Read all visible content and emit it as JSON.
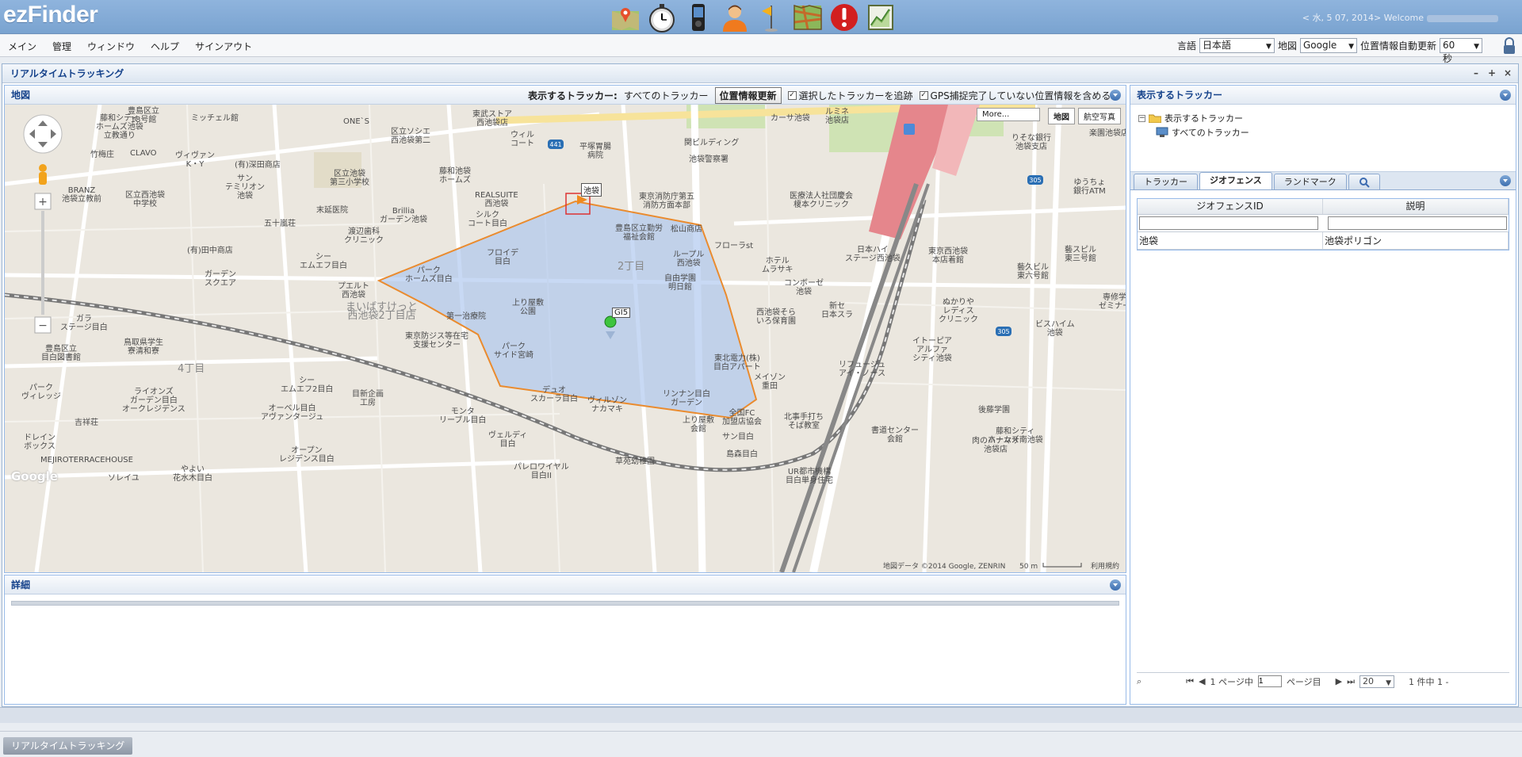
{
  "header": {
    "logo": "ezFinder",
    "welcome": "< 水, 5 07, 2014> Welcome",
    "toolbar_icons": [
      "map-tracker-icon",
      "stopwatch-icon",
      "device-icon",
      "user-icon",
      "flag-icon",
      "route-map-icon",
      "alert-icon",
      "report-icon"
    ]
  },
  "menu": {
    "items": [
      "メイン",
      "管理",
      "ウィンドウ",
      "ヘルプ",
      "サインアウト"
    ]
  },
  "settings": {
    "lang_label": "言語",
    "lang_value": "日本語",
    "map_label": "地図",
    "map_value": "Google",
    "refresh_label": "位置情報自動更新",
    "refresh_value": "60 秒"
  },
  "window": {
    "title": "リアルタイムトラッキング"
  },
  "map_panel": {
    "title": "地図",
    "tracker_label": "表示するトラッカー:",
    "tracker_value": "すべてのトラッカー",
    "update_button": "位置情報更新",
    "chk_follow": "選択したトラッカーを追跡",
    "chk_gps": "GPS捕捉完了していない位置情報を含める",
    "more_button": "More...",
    "map_type_map": "地図",
    "map_type_sat": "航空写真",
    "geo_label": "池袋",
    "tracker_name": "GI5",
    "attribution": "地図データ ©2014 Google, ZENRIN",
    "scale": "50 m",
    "terms": "利用規約",
    "google": "Google"
  },
  "map_labels": [
    {
      "t": "豊島区立\n18号館",
      "l": 155,
      "tp": 3
    },
    {
      "t": "ミッチェル館",
      "l": 235,
      "tp": 12
    },
    {
      "t": "藤和シティ\nホームズ池袋\n立教通り",
      "l": 115,
      "tp": 12
    },
    {
      "t": "ONE`S",
      "l": 427,
      "tp": 16
    },
    {
      "t": "東武ストア\n西池袋店",
      "l": 590,
      "tp": 7
    },
    {
      "t": "ルミネ\n池袋店",
      "l": 1035,
      "tp": 4
    },
    {
      "t": "カーサ池袋",
      "l": 966,
      "tp": 12
    },
    {
      "t": "ウィル\nコート",
      "l": 638,
      "tp": 33
    },
    {
      "t": "平塚胃腸\n病院",
      "l": 725,
      "tp": 48
    },
    {
      "t": "関ビルディング",
      "l": 857,
      "tp": 43
    },
    {
      "t": "池袋警察署",
      "l": 863,
      "tp": 64
    },
    {
      "t": "区立池袋\n第三小学校",
      "l": 410,
      "tp": 82
    },
    {
      "t": "藤和池袋\nホームズ",
      "l": 548,
      "tp": 79
    },
    {
      "t": "CLAVO",
      "l": 158,
      "tp": 56
    },
    {
      "t": "竹梅庄",
      "l": 108,
      "tp": 58
    },
    {
      "t": "ヴィヴァン\nK・Y",
      "l": 215,
      "tp": 59
    },
    {
      "t": "(有)深田商店",
      "l": 290,
      "tp": 71
    },
    {
      "t": "区立ソシエ\n西池袋第二",
      "l": 487,
      "tp": 29
    },
    {
      "t": "BRANZ\n池袋立教前",
      "l": 72,
      "tp": 103
    },
    {
      "t": "区立西池袋\n中学校",
      "l": 152,
      "tp": 109
    },
    {
      "t": "サン\nテミリオン\n池袋",
      "l": 278,
      "tp": 88
    },
    {
      "t": "REALSUITE\n西池袋",
      "l": 593,
      "tp": 109
    },
    {
      "t": "東京消防庁第五\n消防方面本部",
      "l": 800,
      "tp": 111
    },
    {
      "t": "医療法人社団慶会\n榎本クリニック",
      "l": 990,
      "tp": 110
    },
    {
      "t": "末延医院",
      "l": 393,
      "tp": 128
    },
    {
      "t": "Brillia\nガーデン池袋",
      "l": 473,
      "tp": 129
    },
    {
      "t": "シルク\nコート目白",
      "l": 584,
      "tp": 134
    },
    {
      "t": "五十嵐荘",
      "l": 327,
      "tp": 145
    },
    {
      "t": "豊島区立勤労\n福祉会館",
      "l": 770,
      "tp": 151
    },
    {
      "t": "松山商店",
      "l": 840,
      "tp": 152
    },
    {
      "t": "渡辺歯科\nクリニック",
      "l": 428,
      "tp": 155
    },
    {
      "t": "フローラst",
      "l": 895,
      "tp": 173
    },
    {
      "t": "(有)田中商店",
      "l": 230,
      "tp": 179
    },
    {
      "t": "フロイデ\n目白",
      "l": 608,
      "tp": 182
    },
    {
      "t": "ループル\n西池袋",
      "l": 843,
      "tp": 184
    },
    {
      "t": "シー\nエムエフ目白",
      "l": 372,
      "tp": 187
    },
    {
      "t": "日本ハイ\nステージ西池袋",
      "l": 1060,
      "tp": 178
    },
    {
      "t": "ホテル\nムラサキ",
      "l": 955,
      "tp": 192
    },
    {
      "t": "パーク\nホームズ目白",
      "l": 505,
      "tp": 204
    },
    {
      "t": "2丁目",
      "l": 773,
      "tp": 199
    },
    {
      "t": "自由学園\n明日館",
      "l": 832,
      "tp": 214
    },
    {
      "t": "ガーデン\nスクエア",
      "l": 252,
      "tp": 209
    },
    {
      "t": "プエルト\n西池袋",
      "l": 420,
      "tp": 224
    },
    {
      "t": "コンボーゼ\n池袋",
      "l": 983,
      "tp": 220
    },
    {
      "t": "上り屋敷\n公園",
      "l": 640,
      "tp": 245
    },
    {
      "t": "まいばすけっと\n西池袋2丁目店",
      "l": 430,
      "tp": 250
    },
    {
      "t": "西池袋そら\nいろ保育園",
      "l": 948,
      "tp": 257
    },
    {
      "t": "新セ\n日本スラ",
      "l": 1030,
      "tp": 249
    },
    {
      "t": "第一治療院",
      "l": 557,
      "tp": 262
    },
    {
      "t": "ガラ\nステージ目白",
      "l": 70,
      "tp": 265
    },
    {
      "t": "東京防ジス等在宅\n支援センター",
      "l": 505,
      "tp": 287
    },
    {
      "t": "パーク\nサイド宮崎",
      "l": 617,
      "tp": 300
    },
    {
      "t": "鳥取県学生\n寮清和寮",
      "l": 150,
      "tp": 295
    },
    {
      "t": "豊島区立\n目白図書館",
      "l": 46,
      "tp": 303
    },
    {
      "t": "東北電力(株)\n目白アパート",
      "l": 894,
      "tp": 315
    },
    {
      "t": "4丁目",
      "l": 218,
      "tp": 328
    },
    {
      "t": "リフュージュ\nアイ・ノース",
      "l": 1052,
      "tp": 323
    },
    {
      "t": "メイゾン\n重田",
      "l": 945,
      "tp": 339
    },
    {
      "t": "シー\nエムエフ2目白",
      "l": 348,
      "tp": 343
    },
    {
      "t": "パーク\nヴィレッジ",
      "l": 21,
      "tp": 352
    },
    {
      "t": "ライオンズ\nガーデン目白\nオークレジデンス",
      "l": 148,
      "tp": 357
    },
    {
      "t": "目新企画\n工房",
      "l": 438,
      "tp": 360
    },
    {
      "t": "デュオ\nスカーラ目白",
      "l": 663,
      "tp": 355
    },
    {
      "t": "リンナン目白\nガーデン",
      "l": 830,
      "tp": 360
    },
    {
      "t": "ヴィルゾン\nナカマキ",
      "l": 735,
      "tp": 368
    },
    {
      "t": "オーベル目白\nアヴァンタージュ",
      "l": 323,
      "tp": 378
    },
    {
      "t": "モンタ\nリーブル目白",
      "l": 548,
      "tp": 382
    },
    {
      "t": "全国FC\n加盟店協会",
      "l": 905,
      "tp": 384
    },
    {
      "t": "北事手打ち\nそば教室",
      "l": 983,
      "tp": 389
    },
    {
      "t": "上り屋敷\n会館",
      "l": 855,
      "tp": 393
    },
    {
      "t": "吉祥荘",
      "l": 88,
      "tp": 396
    },
    {
      "t": "ヴェルディ\n目白",
      "l": 610,
      "tp": 412
    },
    {
      "t": "サン目白",
      "l": 905,
      "tp": 414
    },
    {
      "t": "オープン\nレジデンス目白",
      "l": 346,
      "tp": 431
    },
    {
      "t": "ドレイン\nボックス",
      "l": 24,
      "tp": 415
    },
    {
      "t": "MEJIROTERRACEHOUSE",
      "l": 45,
      "tp": 443
    },
    {
      "t": "島森目白",
      "l": 910,
      "tp": 436
    },
    {
      "t": "草苑幼稚園",
      "l": 770,
      "tp": 445
    },
    {
      "t": "パレロワイヤル\n目白II",
      "l": 642,
      "tp": 452
    },
    {
      "t": "やよい\n花水木目白",
      "l": 212,
      "tp": 455
    },
    {
      "t": "ソレイユ",
      "l": 130,
      "tp": 466
    },
    {
      "t": "UR都市機構\n目白単身住宅",
      "l": 985,
      "tp": 458
    },
    {
      "t": "藤和シティ\nホームズ南池袋",
      "l": 1240,
      "tp": 407
    },
    {
      "t": "肉のハナマサ\n池袋店",
      "l": 1220,
      "tp": 419
    },
    {
      "t": "書道センター\n会館",
      "l": 1093,
      "tp": 406
    },
    {
      "t": "後藤学園",
      "l": 1228,
      "tp": 380
    },
    {
      "t": "イトーピア\nアルファ\nシティ池袋",
      "l": 1145,
      "tp": 293
    },
    {
      "t": "ぬかりや\nレディス\nクリニック",
      "l": 1178,
      "tp": 244
    },
    {
      "t": "ビスハイム\n池袋",
      "l": 1300,
      "tp": 272
    },
    {
      "t": "藝スピル\n東三号館",
      "l": 1337,
      "tp": 178
    },
    {
      "t": "藝久ビル\n東六号館",
      "l": 1277,
      "tp": 200
    },
    {
      "t": "東京西池袋\n本店着館",
      "l": 1165,
      "tp": 180
    },
    {
      "t": "りそな銀行\n池袋支店",
      "l": 1270,
      "tp": 37
    },
    {
      "t": "楽園池袋店",
      "l": 1368,
      "tp": 31
    },
    {
      "t": "ゆうちょ\n銀行ATM",
      "l": 1348,
      "tp": 93
    },
    {
      "t": "専修学\nゼミナー",
      "l": 1380,
      "tp": 238
    }
  ],
  "detail_panel": {
    "title": "詳細"
  },
  "right_panel": {
    "title": "表示するトラッカー",
    "tree_root": "表示するトラッカー",
    "tree_child": "すべてのトラッカー",
    "tabs": [
      "トラッカー",
      "ジオフェンス",
      "ランドマーク"
    ],
    "grid_headers": [
      "ジオフェンスID",
      "説明"
    ],
    "rows": [
      [
        "池袋",
        "池袋ポリゴン"
      ]
    ],
    "pager_prefix": "1 ページ中",
    "page_value": "1",
    "pager_suffix": "ページ目",
    "page_size": "20",
    "page_count": "1 件中 1 -"
  },
  "taskbar": {
    "item": "リアルタイムトラッキング"
  }
}
